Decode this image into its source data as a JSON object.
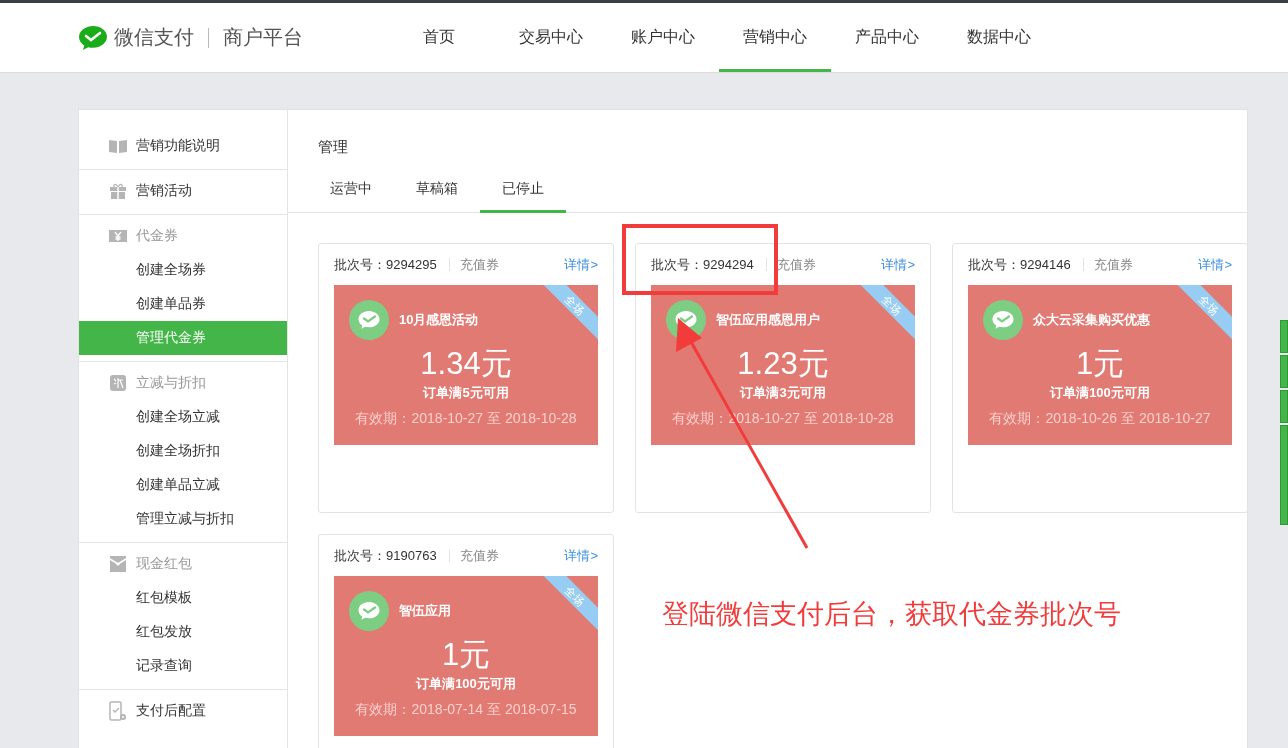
{
  "logo": {
    "brand": "微信支付",
    "subtitle": "商户平台"
  },
  "nav": [
    {
      "label": "首页",
      "selected": false
    },
    {
      "label": "交易中心",
      "selected": false
    },
    {
      "label": "账户中心",
      "selected": false
    },
    {
      "label": "营销中心",
      "selected": true
    },
    {
      "label": "产品中心",
      "selected": false
    },
    {
      "label": "数据中心",
      "selected": false
    }
  ],
  "sidebar": {
    "groups": [
      {
        "label": "营销功能说明",
        "kind": "link"
      },
      {
        "label": "营销活动",
        "kind": "link"
      },
      {
        "label": "代金券",
        "kind": "heading",
        "items": [
          {
            "label": "创建全场券",
            "selected": false
          },
          {
            "label": "创建单品券",
            "selected": false
          },
          {
            "label": "管理代金券",
            "selected": true
          }
        ]
      },
      {
        "label": "立减与折扣",
        "kind": "heading",
        "items": [
          {
            "label": "创建全场立减",
            "selected": false
          },
          {
            "label": "创建全场折扣",
            "selected": false
          },
          {
            "label": "创建单品立减",
            "selected": false
          },
          {
            "label": "管理立减与折扣",
            "selected": false
          }
        ]
      },
      {
        "label": "现金红包",
        "kind": "heading",
        "items": [
          {
            "label": "红包模板",
            "selected": false
          },
          {
            "label": "红包发放",
            "selected": false
          },
          {
            "label": "记录查询",
            "selected": false
          }
        ]
      },
      {
        "label": "支付后配置",
        "kind": "link"
      }
    ]
  },
  "panel": {
    "title": "管理",
    "tabs": [
      {
        "label": "运营中",
        "selected": false
      },
      {
        "label": "草稿箱",
        "selected": false
      },
      {
        "label": "已停止",
        "selected": true
      }
    ],
    "coupons": [
      {
        "batch": "批次号：9294295",
        "type": "充值券",
        "detail_link": "详情>",
        "name": "10月感恩活动",
        "amount": "1.34元",
        "condition": "订单满5元可用",
        "validity": "有效期：2018-10-27 至 2018-10-28",
        "ribbon": "全场"
      },
      {
        "batch": "批次号：9294294",
        "type": "充值券",
        "detail_link": "详情>",
        "name": "智伍应用感恩用户",
        "amount": "1.23元",
        "condition": "订单满3元可用",
        "validity": "有效期：2018-10-27 至 2018-10-28",
        "ribbon": "全场"
      },
      {
        "batch": "批次号：9294146",
        "type": "充值券",
        "detail_link": "详情>",
        "name": "众大云采集购买优惠",
        "amount": "1元",
        "condition": "订单满100元可用",
        "validity": "有效期：2018-10-26 至 2018-10-27",
        "ribbon": "全场"
      },
      {
        "batch": "批次号：9190763",
        "type": "充值券",
        "detail_link": "详情>",
        "name": "智伍应用",
        "amount": "1元",
        "condition": "订单满100元可用",
        "validity": "有效期：2018-07-14 至 2018-07-15",
        "ribbon": "全场"
      }
    ]
  },
  "annotation": {
    "text": "登陆微信支付后台，获取代金券批次号"
  }
}
